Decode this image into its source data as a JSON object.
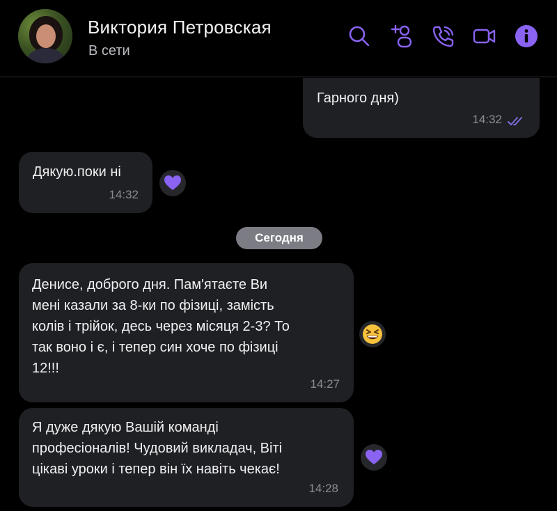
{
  "header": {
    "name": "Виктория Петровская",
    "status": "В сети",
    "icons": [
      "search-icon",
      "add-user-icon",
      "call-icon",
      "video-icon",
      "info-icon"
    ],
    "accent": "#8a63f2"
  },
  "messages": [
    {
      "direction": "outgoing",
      "text": "Гарного дня)",
      "time": "14:32",
      "read": true
    },
    {
      "direction": "incoming",
      "text": "Дякую.поки ні",
      "time": "14:32",
      "reaction": "purple-heart"
    },
    {
      "direction": "incoming",
      "text": "Денисе, доброго дня. Пам'ятаєте Ви\nмені казали за 8-ки по фізиці, замість\nколів і трійок, десь через місяця 2-3? То\nтак воно і є, і тепер син хоче по фізиці\n12!!!",
      "time": "14:27",
      "reaction": "grinning-squinting-face"
    },
    {
      "direction": "incoming",
      "text": "Я дуже дякую Вашій команді\nпрофесіоналів! Чудовий викладач, Віті\nцікаві уроки і тепер він їх навіть чекає!",
      "time": "14:28",
      "reaction": "purple-heart"
    }
  ],
  "date_separator": "Сегодня"
}
